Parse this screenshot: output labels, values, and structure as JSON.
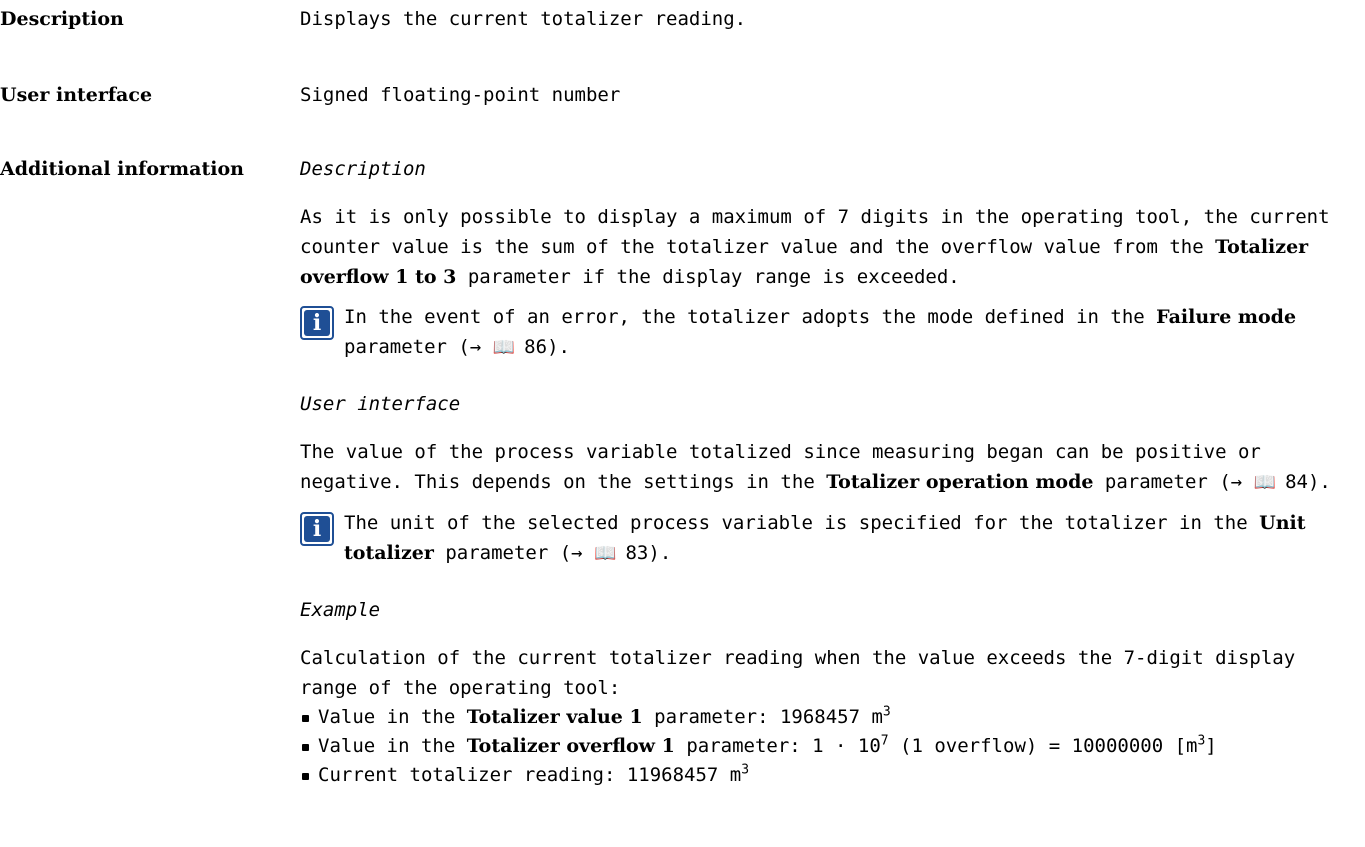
{
  "rows": {
    "description": {
      "label": "Description",
      "text": "Displays the current totalizer reading."
    },
    "user_interface": {
      "label": "User interface",
      "text": "Signed floating-point number"
    },
    "additional": {
      "label": "Additional information"
    }
  },
  "sec1": {
    "heading": "Description",
    "p1": "As it is only possible to display a maximum of 7 digits in the operating tool, the current counter value is the sum of the totalizer value and the overflow value from the ",
    "p1_bold": "Totalizer overflow 1 to 3",
    "p1_end": " parameter if the display range is exceeded.",
    "note_a": "In the event of an error, the totalizer adopts the mode defined in the ",
    "note_bold": "Failure mode",
    "note_b": " parameter (→ ",
    "note_page": "86",
    "note_end": ")."
  },
  "sec2": {
    "heading": "User interface",
    "p1": "The value of the process variable totalized since measuring began can be positive or negative. This depends on the settings in the ",
    "p1_bold": "Totalizer operation mode",
    "p1_b": " parameter (→ ",
    "p1_page": "84",
    "p1_end": ").",
    "note_a": "The unit of the selected process variable is specified for the totalizer in the ",
    "note_bold": "Unit totalizer",
    "note_b": " parameter (→ ",
    "note_page": "83",
    "note_end": ")."
  },
  "sec3": {
    "heading": "Example",
    "p1": "Calculation of the current totalizer reading when the value exceeds the 7-digit display range of the operating tool:",
    "b1_a": "Value in the ",
    "b1_bold": "Totalizer value 1",
    "b1_b": " parameter: 1968457 m",
    "b2_a": "Value in the ",
    "b2_bold": "Totalizer overflow 1",
    "b2_b": " parameter: 1 · 10",
    "b2_c": " (1 overflow) = 10000000 [m",
    "b2_d": "]",
    "b3_a": "Current totalizer reading: 11968457 m",
    "sup3": "3",
    "sup7": "7"
  },
  "icons": {
    "info": "i",
    "book": "📖"
  }
}
